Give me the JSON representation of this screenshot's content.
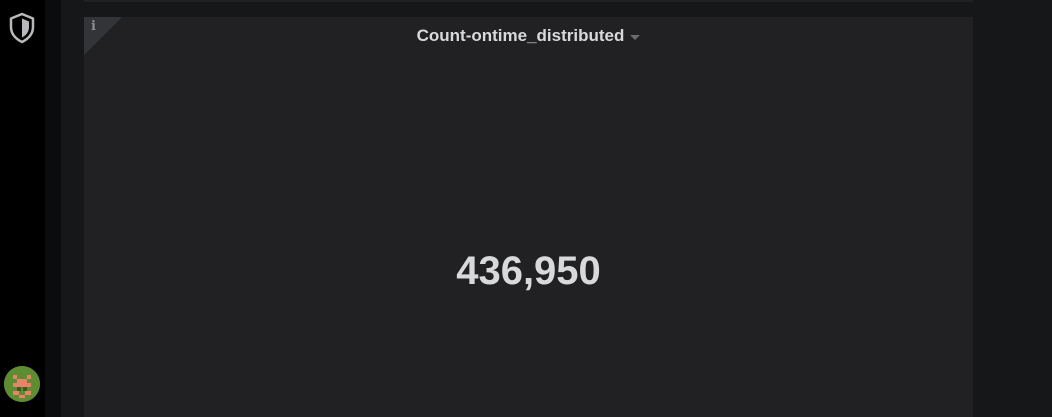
{
  "sidemenu": {
    "logo_icon": "grafana-shield-icon",
    "avatar_icon": "user-avatar-identicon"
  },
  "panel": {
    "info_label": "i",
    "title": "Count-ontime_distributed",
    "title_menu_icon": "caret-down-icon",
    "value": "436,950"
  },
  "colors": {
    "background": "#161719",
    "sidemenu": "#000000",
    "panel": "#212124",
    "text": "#d8d9da",
    "muted": "#8e8e8e"
  }
}
